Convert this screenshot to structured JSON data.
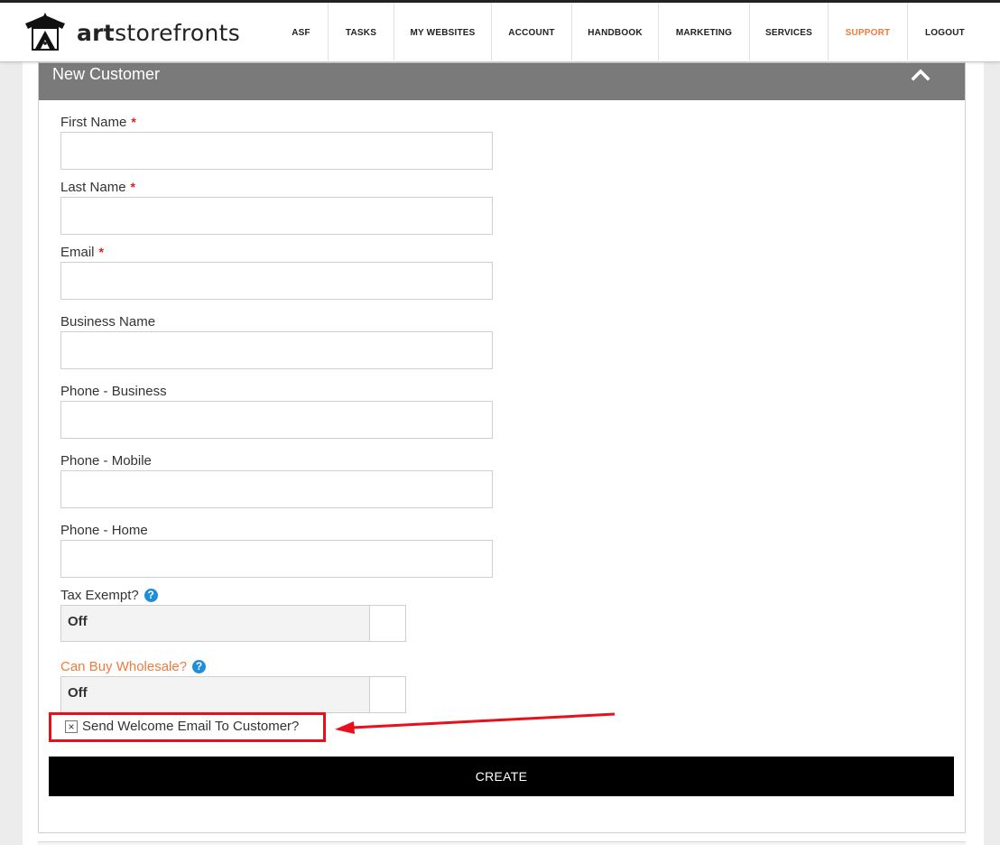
{
  "brand": {
    "name_bold": "art",
    "name_rest": "storefronts"
  },
  "nav": [
    {
      "label": "ASF"
    },
    {
      "label": "TASKS"
    },
    {
      "label": "MY WEBSITES"
    },
    {
      "label": "ACCOUNT"
    },
    {
      "label": "HANDBOOK"
    },
    {
      "label": "MARKETING"
    },
    {
      "label": "SERVICES"
    },
    {
      "label": "SUPPORT",
      "active": true
    },
    {
      "label": "LOGOUT"
    }
  ],
  "panel": {
    "title": "New Customer"
  },
  "form": {
    "first_name_label": "First Name",
    "last_name_label": "Last Name",
    "email_label": "Email",
    "business_name_label": "Business Name",
    "phone_business_label": "Phone - Business",
    "phone_mobile_label": "Phone - Mobile",
    "phone_home_label": "Phone - Home",
    "required_mark": "*",
    "tax_exempt_label": "Tax Exempt?",
    "tax_exempt_value": "Off",
    "wholesale_label": "Can Buy Wholesale?",
    "wholesale_value": "Off",
    "help_glyph": "?",
    "welcome_email_label": "Send Welcome Email To Customer?",
    "welcome_email_checked_glyph": "×",
    "create_label": "CREATE"
  },
  "colors": {
    "accent": "#f07a3b",
    "required": "#e0201b",
    "help": "#1f8ed8",
    "panel_header": "#7a7a7a",
    "annotation": "#e8101a"
  },
  "icons": {
    "collapse": "chevron-up-icon",
    "help": "question-circle-icon",
    "logo": "tent-logo-icon"
  }
}
